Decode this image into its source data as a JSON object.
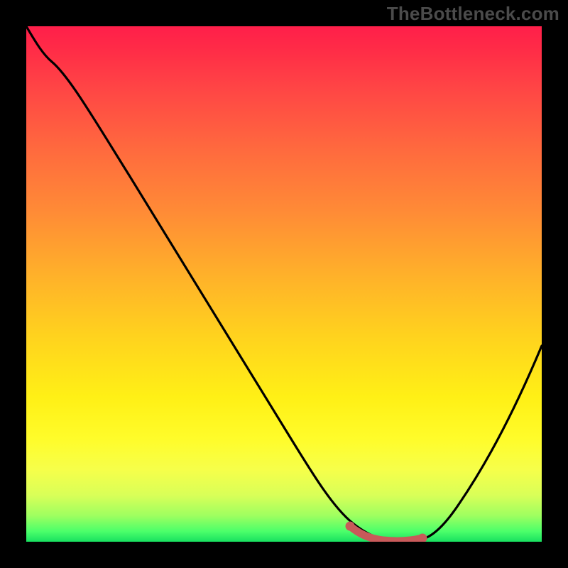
{
  "watermark": "TheBottleneck.com",
  "chart_data": {
    "type": "line",
    "title": "",
    "xlabel": "",
    "ylabel": "",
    "xlim": [
      0,
      100
    ],
    "ylim": [
      0,
      100
    ],
    "series": [
      {
        "name": "curve",
        "x": [
          0,
          5,
          10,
          20,
          30,
          40,
          50,
          58,
          63,
          67,
          72,
          76,
          80,
          85,
          90,
          95,
          100
        ],
        "values": [
          100,
          97,
          94,
          82,
          68,
          54,
          39,
          24,
          12,
          4,
          0,
          0,
          3,
          10,
          19,
          28,
          38
        ]
      },
      {
        "name": "highlight-segment",
        "x": [
          63,
          67,
          72,
          76
        ],
        "values": [
          4,
          1,
          0,
          1
        ]
      }
    ],
    "gradient_stops": [
      {
        "pos": 0,
        "color": "#ff1f4a"
      },
      {
        "pos": 50,
        "color": "#ffb02a"
      },
      {
        "pos": 80,
        "color": "#fffc2a"
      },
      {
        "pos": 100,
        "color": "#18e060"
      }
    ]
  }
}
